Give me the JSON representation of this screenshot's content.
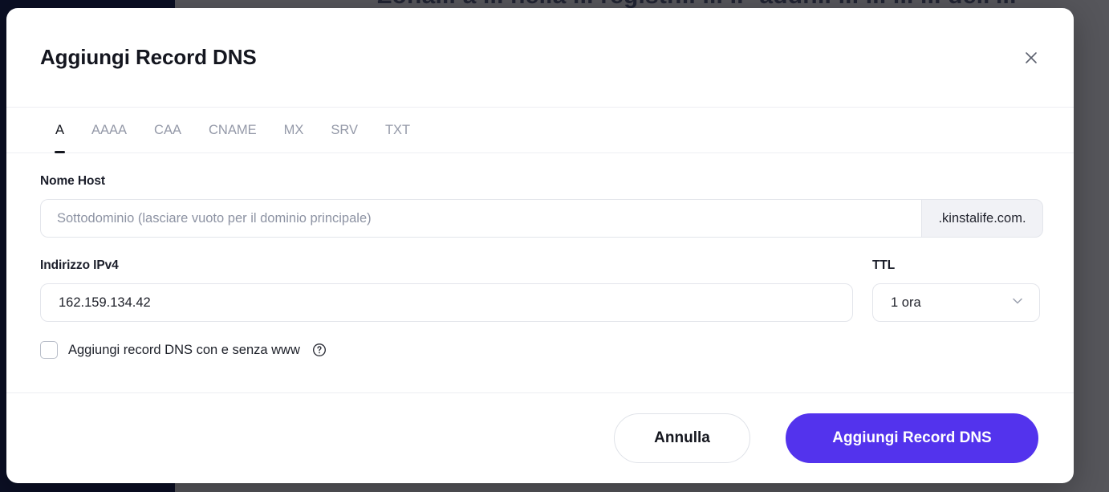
{
  "backdrop": {
    "obscured_text": "Zona... a ... nella ... registr... ... IP addr... ... ... ... ... dell'...",
    "sidebar_color": "#0b0f24",
    "overlay_color": "#56565b"
  },
  "modal": {
    "title": "Aggiungi Record DNS",
    "close_icon": "close-icon",
    "tabs": [
      {
        "label": "A",
        "active": true
      },
      {
        "label": "AAAA",
        "active": false
      },
      {
        "label": "CAA",
        "active": false
      },
      {
        "label": "CNAME",
        "active": false
      },
      {
        "label": "MX",
        "active": false
      },
      {
        "label": "SRV",
        "active": false
      },
      {
        "label": "TXT",
        "active": false
      }
    ],
    "fields": {
      "host": {
        "label": "Nome Host",
        "placeholder": "Sottodominio (lasciare vuoto per il dominio principale)",
        "value": "",
        "suffix": ".kinstalife.com."
      },
      "ipv4": {
        "label": "Indirizzo IPv4",
        "value": "162.159.134.42",
        "placeholder": ""
      },
      "ttl": {
        "label": "TTL",
        "value": "1 ora",
        "chevron_icon": "chevron-down-icon"
      }
    },
    "checkbox": {
      "label": "Aggiungi record DNS con e senza www",
      "checked": false,
      "help_icon": "question-circle-icon"
    },
    "footer": {
      "cancel_label": "Annulla",
      "submit_label": "Aggiungi Record DNS"
    }
  },
  "colors": {
    "primary": "#5333ed",
    "text": "#14161f",
    "muted": "#9499a8",
    "border": "#e3e5eb"
  }
}
